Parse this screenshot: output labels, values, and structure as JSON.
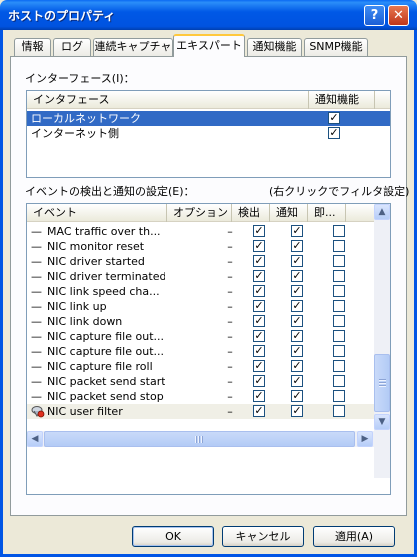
{
  "window": {
    "title": "ホストのプロパティ",
    "help_label": "?",
    "close_label": "✕"
  },
  "tabs": [
    {
      "label": "情報",
      "active": false
    },
    {
      "label": "ログ",
      "active": false
    },
    {
      "label": "連続キャプチャ",
      "active": false
    },
    {
      "label": "エキスパート",
      "active": true
    },
    {
      "label": "通知機能",
      "active": false
    },
    {
      "label": "SNMP機能",
      "active": false
    }
  ],
  "interfaces": {
    "label": "インターフェース(I)：",
    "columns": {
      "name": "インタフェース",
      "notify": "通知機能"
    },
    "rows": [
      {
        "name": "ローカルネットワーク",
        "notify": true,
        "selected": true
      },
      {
        "name": "インターネット側",
        "notify": true,
        "selected": false
      }
    ]
  },
  "events": {
    "label": "イベントの検出と通知の設定(E)：",
    "hint": "(右クリックでフィルタ設定)",
    "columns": {
      "event": "イベント",
      "option": "オプション",
      "detect": "検出",
      "notify": "通知",
      "immediate": "即..."
    },
    "rows": [
      {
        "prefix": "—",
        "name": "MAC traffic over th...",
        "option": "–",
        "detect": true,
        "notify": true,
        "immediate": false
      },
      {
        "prefix": "—",
        "name": "NIC monitor reset",
        "option": "–",
        "detect": true,
        "notify": true,
        "immediate": false
      },
      {
        "prefix": "—",
        "name": "NIC driver started",
        "option": "–",
        "detect": true,
        "notify": true,
        "immediate": false
      },
      {
        "prefix": "—",
        "name": "NIC driver terminated",
        "option": "–",
        "detect": true,
        "notify": true,
        "immediate": false
      },
      {
        "prefix": "—",
        "name": "NIC link speed cha...",
        "option": "–",
        "detect": true,
        "notify": true,
        "immediate": false
      },
      {
        "prefix": "—",
        "name": "NIC link up",
        "option": "–",
        "detect": true,
        "notify": true,
        "immediate": false
      },
      {
        "prefix": "—",
        "name": "NIC link down",
        "option": "–",
        "detect": true,
        "notify": true,
        "immediate": false
      },
      {
        "prefix": "—",
        "name": "NIC capture file out...",
        "option": "–",
        "detect": true,
        "notify": true,
        "immediate": false
      },
      {
        "prefix": "—",
        "name": "NIC capture file out...",
        "option": "–",
        "detect": true,
        "notify": true,
        "immediate": false
      },
      {
        "prefix": "—",
        "name": "NIC capture file roll",
        "option": "–",
        "detect": true,
        "notify": true,
        "immediate": false
      },
      {
        "prefix": "—",
        "name": "NIC packet send start",
        "option": "–",
        "detect": true,
        "notify": true,
        "immediate": false
      },
      {
        "prefix": "—",
        "name": "NIC packet send stop",
        "option": "–",
        "detect": true,
        "notify": true,
        "immediate": false
      },
      {
        "prefix": "",
        "name": "NIC user filter",
        "option": "–",
        "detect": true,
        "notify": true,
        "immediate": false,
        "filter_icon": true
      }
    ]
  },
  "buttons": {
    "ok": "OK",
    "cancel": "キャンセル",
    "apply": "適用(A)"
  },
  "icons": {
    "check": "✓",
    "scroll_up": "▲",
    "scroll_down": "▼",
    "scroll_left": "◀",
    "scroll_right": "▶"
  }
}
